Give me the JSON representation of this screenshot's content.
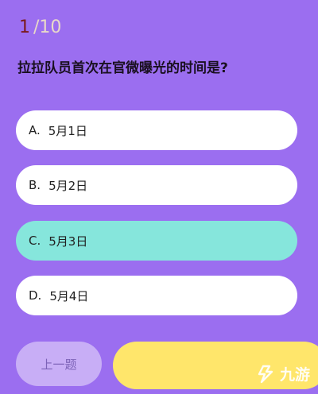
{
  "progress": {
    "current": "1",
    "total": "/10"
  },
  "question": "拉拉队员首次在官微曝光的时间是?",
  "options": [
    {
      "letter": "A.",
      "text": "5月1日",
      "selected": false
    },
    {
      "letter": "B.",
      "text": "5月2日",
      "selected": false
    },
    {
      "letter": "C.",
      "text": "5月3日",
      "selected": true
    },
    {
      "letter": "D.",
      "text": "5月4日",
      "selected": false
    }
  ],
  "buttons": {
    "prev_label": "上一题",
    "next_label": ""
  },
  "watermark": {
    "text": "九游",
    "icon": "jiuyou-logo-icon"
  },
  "colors": {
    "background": "#9b6ef0",
    "option_bg": "#ffffff",
    "option_selected": "#86e6dc",
    "prev_button": "#c8aef6",
    "next_button": "#ffe66b"
  }
}
